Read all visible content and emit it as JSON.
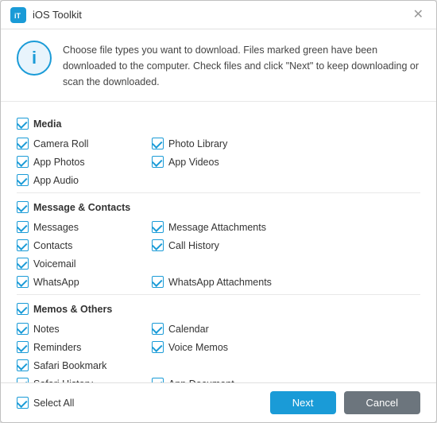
{
  "titlebar": {
    "icon_label": "iT",
    "title": "iOS Toolkit",
    "close_label": "✕"
  },
  "info": {
    "icon_label": "i",
    "text": "Choose file types you want to download. Files marked green have been downloaded to the computer. Check files and click \"Next\" to keep downloading or scan the downloaded."
  },
  "sections": [
    {
      "id": "media",
      "header": "Media",
      "items": [
        {
          "id": "camera-roll",
          "label": "Camera Roll",
          "checked": true,
          "col": 1
        },
        {
          "id": "photo-library",
          "label": "Photo Library",
          "checked": true,
          "col": 2
        },
        {
          "id": "app-photos",
          "label": "App Photos",
          "checked": true,
          "col": 3
        },
        {
          "id": "app-videos",
          "label": "App Videos",
          "checked": true,
          "col": 1
        },
        {
          "id": "app-audio",
          "label": "App Audio",
          "checked": true,
          "col": 2
        }
      ]
    },
    {
      "id": "message-contacts",
      "header": "Message & Contacts",
      "items": [
        {
          "id": "messages",
          "label": "Messages",
          "checked": true,
          "col": 1
        },
        {
          "id": "message-attachments",
          "label": "Message Attachments",
          "checked": true,
          "col": 2
        },
        {
          "id": "contacts",
          "label": "Contacts",
          "checked": true,
          "col": 3
        },
        {
          "id": "call-history",
          "label": "Call History",
          "checked": true,
          "col": 1
        },
        {
          "id": "voicemail",
          "label": "Voicemail",
          "checked": true,
          "col": 2
        },
        {
          "id": "whatsapp",
          "label": "WhatsApp",
          "checked": true,
          "col": 1
        },
        {
          "id": "whatsapp-attachments",
          "label": "WhatsApp Attachments",
          "checked": true,
          "col": 2
        }
      ]
    },
    {
      "id": "memos-others",
      "header": "Memos & Others",
      "items": [
        {
          "id": "notes",
          "label": "Notes",
          "checked": true,
          "col": 1
        },
        {
          "id": "calendar",
          "label": "Calendar",
          "checked": true,
          "col": 2
        },
        {
          "id": "reminders",
          "label": "Reminders",
          "checked": true,
          "col": 3
        },
        {
          "id": "voice-memos",
          "label": "Voice Memos",
          "checked": true,
          "col": 1
        },
        {
          "id": "safari-bookmark",
          "label": "Safari Bookmark",
          "checked": true,
          "col": 2
        },
        {
          "id": "safari-history",
          "label": "Safari History",
          "checked": true,
          "col": 1
        },
        {
          "id": "app-document",
          "label": "App Document",
          "checked": true,
          "col": 2
        }
      ]
    }
  ],
  "footer": {
    "select_all_label": "Select All",
    "select_all_checked": true,
    "next_label": "Next",
    "cancel_label": "Cancel"
  }
}
